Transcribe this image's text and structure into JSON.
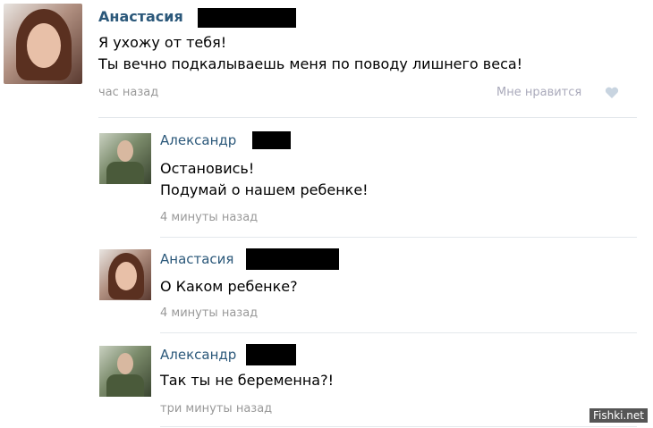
{
  "main_post": {
    "author": "Анастасия",
    "lines": [
      "Я ухожу от тебя!",
      "Ты вечно подкалываешь меня по поводу лишнего веса!"
    ],
    "time": "час назад",
    "like_label": "Мне нравится",
    "like_icon": "heart-icon"
  },
  "replies": [
    {
      "author": "Александр",
      "lines": [
        "Остановись!",
        "Подумай о нашем ребенке!"
      ],
      "time": "4 минуты назад"
    },
    {
      "author": "Анастасия",
      "lines": [
        "О Каком ребенке?"
      ],
      "time": "4 минуты назад"
    },
    {
      "author": "Александр",
      "lines": [
        "Так ты не беременна?!"
      ],
      "time": "три минуты назад"
    }
  ],
  "watermark": "Fishki.net"
}
